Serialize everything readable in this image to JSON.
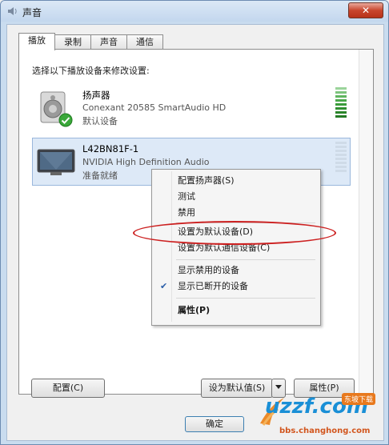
{
  "window": {
    "title": "声音",
    "close_label": "✕"
  },
  "tabs": [
    {
      "label": "播放"
    },
    {
      "label": "录制"
    },
    {
      "label": "声音"
    },
    {
      "label": "通信"
    }
  ],
  "instruction": "选择以下播放设备来修改设置:",
  "devices": [
    {
      "name": "扬声器",
      "description": "Conexant 20585 SmartAudio HD",
      "status": "默认设备",
      "icon": "speaker-icon",
      "default": true
    },
    {
      "name": "L42BN81F-1",
      "description": "NVIDIA High Definition Audio",
      "status": "准备就绪",
      "icon": "monitor-icon",
      "default": false
    }
  ],
  "context_menu": {
    "items": [
      {
        "label": "配置扬声器(S)"
      },
      {
        "label": "测试"
      },
      {
        "label": "禁用"
      },
      {
        "label": "设置为默认设备(D)",
        "highlighted": true
      },
      {
        "label": "设置为默认通信设备(C)"
      },
      {
        "label": "显示禁用的设备"
      },
      {
        "label": "显示已断开的设备",
        "checked": true
      },
      {
        "label": "属性(P)",
        "bold": true
      }
    ]
  },
  "buttons": {
    "configure": "配置(C)",
    "set_default": "设为默认值(S)",
    "properties": "属性(P)",
    "ok": "确定"
  },
  "watermark": {
    "logo": "uzzf.com",
    "tag": "东坡下载",
    "url": "bbs.changhong.com"
  },
  "colors": {
    "selection": "#dde9f7",
    "highlight_oval": "#cc2020",
    "meter_green": "#3aa83a"
  }
}
